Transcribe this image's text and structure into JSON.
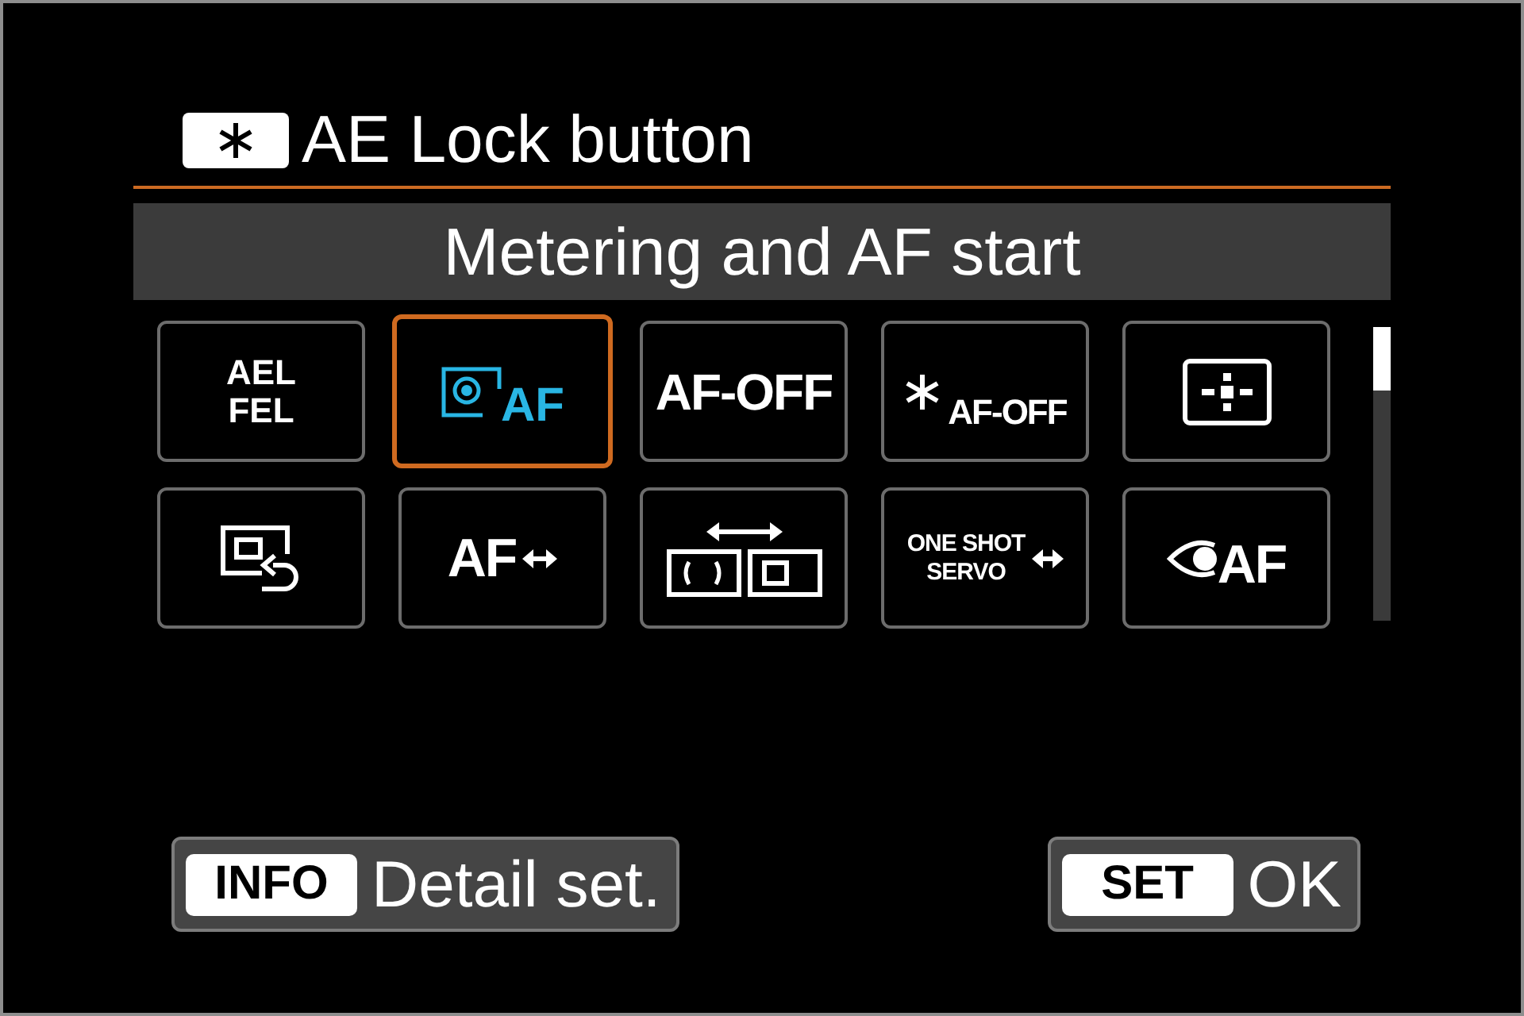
{
  "title": "AE Lock button",
  "function_name": "Metering and AF start",
  "functions": [
    {
      "kind": "stacked_text",
      "lines": [
        "AEL",
        "FEL"
      ],
      "selected": false
    },
    {
      "kind": "metering_af",
      "lines": [
        "AF"
      ],
      "selected": true
    },
    {
      "kind": "text",
      "lines": [
        "AF-OFF"
      ],
      "selected": false
    },
    {
      "kind": "ae_lock_af_off",
      "lines": [
        "AF-OFF"
      ],
      "selected": false
    },
    {
      "kind": "af_point",
      "selected": false
    },
    {
      "kind": "playback",
      "selected": false
    },
    {
      "kind": "af_switch",
      "lines": [
        "AF"
      ],
      "selected": false
    },
    {
      "kind": "area_switch",
      "selected": false
    },
    {
      "kind": "mode_switch",
      "lines": [
        "ONE SHOT",
        "SERVO"
      ],
      "selected": false
    },
    {
      "kind": "eye_af",
      "lines": [
        "AF"
      ],
      "selected": false
    }
  ],
  "footer": [
    {
      "key": "INFO",
      "label": "Detail set."
    },
    {
      "key": "SET",
      "label": "OK"
    }
  ]
}
